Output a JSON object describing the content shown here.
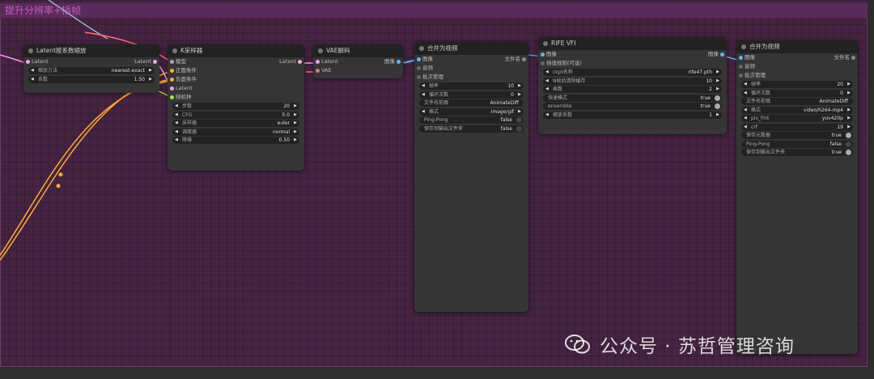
{
  "group": {
    "title": "提升分辨率+插帧"
  },
  "nodes": {
    "latent_upscale": {
      "title": "Latent按系数缩放",
      "inputs": [
        "Latent"
      ],
      "outputs": [
        "Latent"
      ],
      "widgets": [
        {
          "label": "缩放方法",
          "value": "nearest-exact"
        },
        {
          "label": "系数",
          "value": "1.50"
        }
      ]
    },
    "ksampler": {
      "title": "K采样器",
      "inputs": [
        "模型",
        "正面条件",
        "负面条件",
        "Latent",
        "随机种"
      ],
      "outputs": [
        "Latent"
      ],
      "widgets": [
        {
          "label": "步数",
          "value": "20"
        },
        {
          "label": "CFG",
          "value": "5.0"
        },
        {
          "label": "采样器",
          "value": "euler"
        },
        {
          "label": "调度器",
          "value": "normal"
        },
        {
          "label": "降噪",
          "value": "0.50"
        }
      ]
    },
    "vae_decode": {
      "title": "VAE解码",
      "inputs": [
        "Latent",
        "VAE"
      ],
      "outputs": [
        "图像"
      ]
    },
    "combine1": {
      "title": "合并为视频",
      "inputs": [
        "图像",
        "音频",
        "批次管理"
      ],
      "outputs": [
        "文件名"
      ],
      "widgets": [
        {
          "label": "帧率",
          "value": "10",
          "kind": "num"
        },
        {
          "label": "循环次数",
          "value": "0",
          "kind": "num"
        },
        {
          "label": "文件名前缀",
          "value": "AnimateDiff",
          "kind": "text"
        },
        {
          "label": "格式",
          "value": "image/gif",
          "kind": "num"
        },
        {
          "label": "Ping-Pong",
          "value": "false",
          "kind": "toggle"
        },
        {
          "label": "保存到输出文件夹",
          "value": "false",
          "kind": "toggle"
        }
      ]
    },
    "rife": {
      "title": "RIFE VFI",
      "inputs": [
        "图像",
        "插值规则(可选)"
      ],
      "outputs": [
        "图像"
      ],
      "widgets": [
        {
          "label": "ckpt名称",
          "value": "rife47.pth",
          "kind": "num"
        },
        {
          "label": "N帧后清除缓存",
          "value": "10",
          "kind": "num"
        },
        {
          "label": "乘数",
          "value": "2",
          "kind": "num"
        },
        {
          "label": "快速模式",
          "value": "true",
          "kind": "toggle"
        },
        {
          "label": "ensemble",
          "value": "true",
          "kind": "toggle"
        },
        {
          "label": "缩放系数",
          "value": "1",
          "kind": "num"
        }
      ]
    },
    "combine2": {
      "title": "合并为视频",
      "inputs": [
        "图像",
        "音频",
        "批次管理"
      ],
      "outputs": [
        "文件名"
      ],
      "widgets": [
        {
          "label": "帧率",
          "value": "20",
          "kind": "num"
        },
        {
          "label": "循环次数",
          "value": "0",
          "kind": "num"
        },
        {
          "label": "文件名前缀",
          "value": "AnimateDiff",
          "kind": "text"
        },
        {
          "label": "格式",
          "value": "video/h264-mp4",
          "kind": "num"
        },
        {
          "label": "pix_fmt",
          "value": "yuv420p",
          "kind": "num"
        },
        {
          "label": "crf",
          "value": "19",
          "kind": "num"
        },
        {
          "label": "保存元数据",
          "value": "true",
          "kind": "toggle"
        },
        {
          "label": "Ping-Pong",
          "value": "false",
          "kind": "toggle"
        },
        {
          "label": "保存到输出文件夹",
          "value": "true",
          "kind": "toggle"
        }
      ]
    }
  },
  "watermark": {
    "text": "公众号 · 苏哲管理咨询",
    "icon": "wechat-icon"
  },
  "colors": {
    "latent": "#ff9cf9",
    "image": "#64b5f6",
    "model": "#b39ddb",
    "conditioning": "#ffa931",
    "vae": "#ff6e6e",
    "int": "#a1e94b"
  }
}
